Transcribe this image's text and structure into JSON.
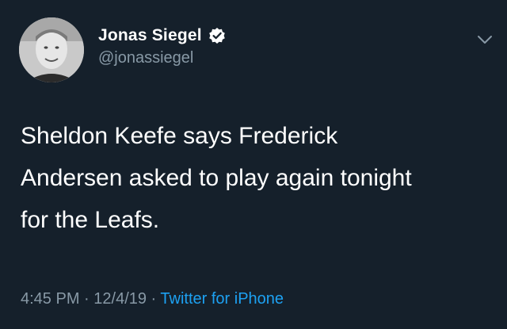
{
  "user": {
    "display_name": "Jonas Siegel",
    "handle": "@jonassiegel",
    "verified": true
  },
  "tweet": {
    "lines": [
      "Sheldon Keefe says Frederick",
      "Andersen asked to play again tonight",
      "for the Leafs."
    ]
  },
  "meta": {
    "time": "4:45 PM",
    "sep1": " · ",
    "date": "12/4/19",
    "sep2": " · ",
    "source": "Twitter for iPhone"
  },
  "icons": {
    "verified": "verified-badge-icon",
    "more": "chevron-down-icon"
  },
  "colors": {
    "background": "#15202b",
    "secondary_text": "#8899a6",
    "link": "#1da1f2"
  }
}
